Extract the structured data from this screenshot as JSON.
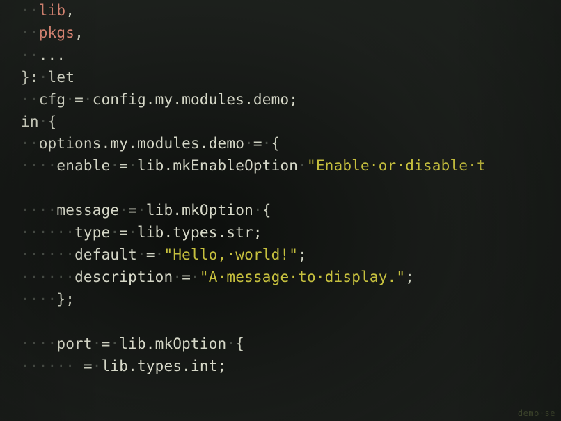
{
  "gutter": [
    "",
    "",
    "",
    "",
    "",
    "",
    "",
    "",
    "",
    "",
    "",
    "",
    "",
    "",
    "",
    "",
    "",
    "",
    ""
  ],
  "code": {
    "l1": {
      "ws": "··",
      "t1": "lib",
      "t2": ","
    },
    "l2": {
      "ws": "··",
      "t1": "pkgs",
      "t2": ","
    },
    "l3": {
      "ws": "··",
      "t1": "..."
    },
    "l4": {
      "t1": "}:",
      "ws": "·",
      "t2": "let"
    },
    "l5": {
      "ws1": "··",
      "t1": "cfg",
      "ws2": "·",
      "eq": "=",
      "ws3": "·",
      "t2": "config.my.modules.demo;"
    },
    "l6": {
      "t1": "in",
      "ws": "·",
      "t2": "{"
    },
    "l7": {
      "ws1": "··",
      "t1": "options.my.modules.demo",
      "ws2": "·",
      "eq": "=",
      "ws3": "·",
      "t2": "{"
    },
    "l8": {
      "ws1": "····",
      "t1": "enable",
      "ws2": "·",
      "eq": "=",
      "ws3": "·",
      "t2": "lib.mkEnableOption",
      "ws4": "·",
      "str": "\"Enable·or·disable·t"
    },
    "l9": {
      "ws": "",
      "blank": " "
    },
    "l10": {
      "ws1": "····",
      "t1": "message",
      "ws2": "·",
      "eq": "=",
      "ws3": "·",
      "t2": "lib.mkOption",
      "ws4": "·",
      "t3": "{"
    },
    "l11": {
      "ws1": "······",
      "t1": "type",
      "ws2": "·",
      "eq": "=",
      "ws3": "·",
      "t2": "lib.types.str;"
    },
    "l12": {
      "ws1": "······",
      "t1": "default",
      "ws2": "·",
      "eq": "=",
      "ws3": "·",
      "str": "\"Hello,·world!\"",
      "t2": ";"
    },
    "l13": {
      "ws1": "······",
      "t1": "description",
      "ws2": "·",
      "eq": "=",
      "ws3": "·",
      "str": "\"A·message·to·display.\"",
      "t2": ";"
    },
    "l14": {
      "ws1": "····",
      "t1": "};"
    },
    "l15": {
      "ws": "",
      "blank": " "
    },
    "l16": {
      "ws1": "····",
      "t1": "port",
      "ws2": "·",
      "eq": "=",
      "ws3": "·",
      "t2": "lib.mkOption",
      "ws4": "·",
      "t3": "{"
    },
    "l17": {
      "ws1": "······",
      "eq": "=",
      "ws2": "·",
      "t1": "lib.types.int;"
    }
  },
  "statusbar": "demo·se"
}
